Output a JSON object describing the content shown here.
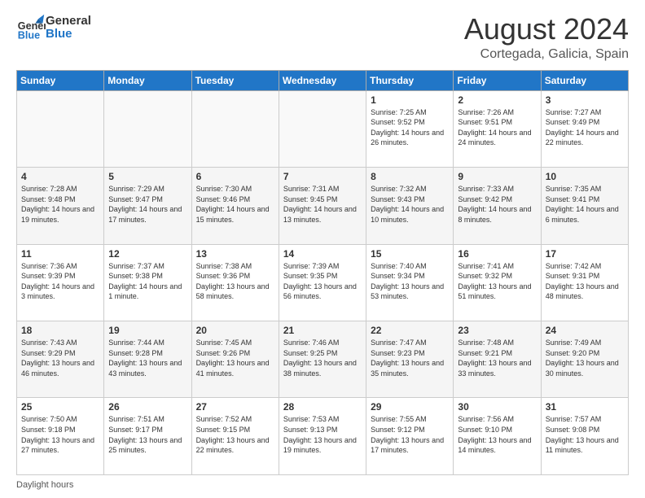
{
  "logo": {
    "line1": "General",
    "line2": "Blue"
  },
  "title": "August 2024",
  "location": "Cortegada, Galicia, Spain",
  "weekdays": [
    "Sunday",
    "Monday",
    "Tuesday",
    "Wednesday",
    "Thursday",
    "Friday",
    "Saturday"
  ],
  "footer_label": "Daylight hours",
  "weeks": [
    [
      {
        "day": "",
        "info": ""
      },
      {
        "day": "",
        "info": ""
      },
      {
        "day": "",
        "info": ""
      },
      {
        "day": "",
        "info": ""
      },
      {
        "day": "1",
        "info": "Sunrise: 7:25 AM\nSunset: 9:52 PM\nDaylight: 14 hours and 26 minutes."
      },
      {
        "day": "2",
        "info": "Sunrise: 7:26 AM\nSunset: 9:51 PM\nDaylight: 14 hours and 24 minutes."
      },
      {
        "day": "3",
        "info": "Sunrise: 7:27 AM\nSunset: 9:49 PM\nDaylight: 14 hours and 22 minutes."
      }
    ],
    [
      {
        "day": "4",
        "info": "Sunrise: 7:28 AM\nSunset: 9:48 PM\nDaylight: 14 hours and 19 minutes."
      },
      {
        "day": "5",
        "info": "Sunrise: 7:29 AM\nSunset: 9:47 PM\nDaylight: 14 hours and 17 minutes."
      },
      {
        "day": "6",
        "info": "Sunrise: 7:30 AM\nSunset: 9:46 PM\nDaylight: 14 hours and 15 minutes."
      },
      {
        "day": "7",
        "info": "Sunrise: 7:31 AM\nSunset: 9:45 PM\nDaylight: 14 hours and 13 minutes."
      },
      {
        "day": "8",
        "info": "Sunrise: 7:32 AM\nSunset: 9:43 PM\nDaylight: 14 hours and 10 minutes."
      },
      {
        "day": "9",
        "info": "Sunrise: 7:33 AM\nSunset: 9:42 PM\nDaylight: 14 hours and 8 minutes."
      },
      {
        "day": "10",
        "info": "Sunrise: 7:35 AM\nSunset: 9:41 PM\nDaylight: 14 hours and 6 minutes."
      }
    ],
    [
      {
        "day": "11",
        "info": "Sunrise: 7:36 AM\nSunset: 9:39 PM\nDaylight: 14 hours and 3 minutes."
      },
      {
        "day": "12",
        "info": "Sunrise: 7:37 AM\nSunset: 9:38 PM\nDaylight: 14 hours and 1 minute."
      },
      {
        "day": "13",
        "info": "Sunrise: 7:38 AM\nSunset: 9:36 PM\nDaylight: 13 hours and 58 minutes."
      },
      {
        "day": "14",
        "info": "Sunrise: 7:39 AM\nSunset: 9:35 PM\nDaylight: 13 hours and 56 minutes."
      },
      {
        "day": "15",
        "info": "Sunrise: 7:40 AM\nSunset: 9:34 PM\nDaylight: 13 hours and 53 minutes."
      },
      {
        "day": "16",
        "info": "Sunrise: 7:41 AM\nSunset: 9:32 PM\nDaylight: 13 hours and 51 minutes."
      },
      {
        "day": "17",
        "info": "Sunrise: 7:42 AM\nSunset: 9:31 PM\nDaylight: 13 hours and 48 minutes."
      }
    ],
    [
      {
        "day": "18",
        "info": "Sunrise: 7:43 AM\nSunset: 9:29 PM\nDaylight: 13 hours and 46 minutes."
      },
      {
        "day": "19",
        "info": "Sunrise: 7:44 AM\nSunset: 9:28 PM\nDaylight: 13 hours and 43 minutes."
      },
      {
        "day": "20",
        "info": "Sunrise: 7:45 AM\nSunset: 9:26 PM\nDaylight: 13 hours and 41 minutes."
      },
      {
        "day": "21",
        "info": "Sunrise: 7:46 AM\nSunset: 9:25 PM\nDaylight: 13 hours and 38 minutes."
      },
      {
        "day": "22",
        "info": "Sunrise: 7:47 AM\nSunset: 9:23 PM\nDaylight: 13 hours and 35 minutes."
      },
      {
        "day": "23",
        "info": "Sunrise: 7:48 AM\nSunset: 9:21 PM\nDaylight: 13 hours and 33 minutes."
      },
      {
        "day": "24",
        "info": "Sunrise: 7:49 AM\nSunset: 9:20 PM\nDaylight: 13 hours and 30 minutes."
      }
    ],
    [
      {
        "day": "25",
        "info": "Sunrise: 7:50 AM\nSunset: 9:18 PM\nDaylight: 13 hours and 27 minutes."
      },
      {
        "day": "26",
        "info": "Sunrise: 7:51 AM\nSunset: 9:17 PM\nDaylight: 13 hours and 25 minutes."
      },
      {
        "day": "27",
        "info": "Sunrise: 7:52 AM\nSunset: 9:15 PM\nDaylight: 13 hours and 22 minutes."
      },
      {
        "day": "28",
        "info": "Sunrise: 7:53 AM\nSunset: 9:13 PM\nDaylight: 13 hours and 19 minutes."
      },
      {
        "day": "29",
        "info": "Sunrise: 7:55 AM\nSunset: 9:12 PM\nDaylight: 13 hours and 17 minutes."
      },
      {
        "day": "30",
        "info": "Sunrise: 7:56 AM\nSunset: 9:10 PM\nDaylight: 13 hours and 14 minutes."
      },
      {
        "day": "31",
        "info": "Sunrise: 7:57 AM\nSunset: 9:08 PM\nDaylight: 13 hours and 11 minutes."
      }
    ]
  ]
}
